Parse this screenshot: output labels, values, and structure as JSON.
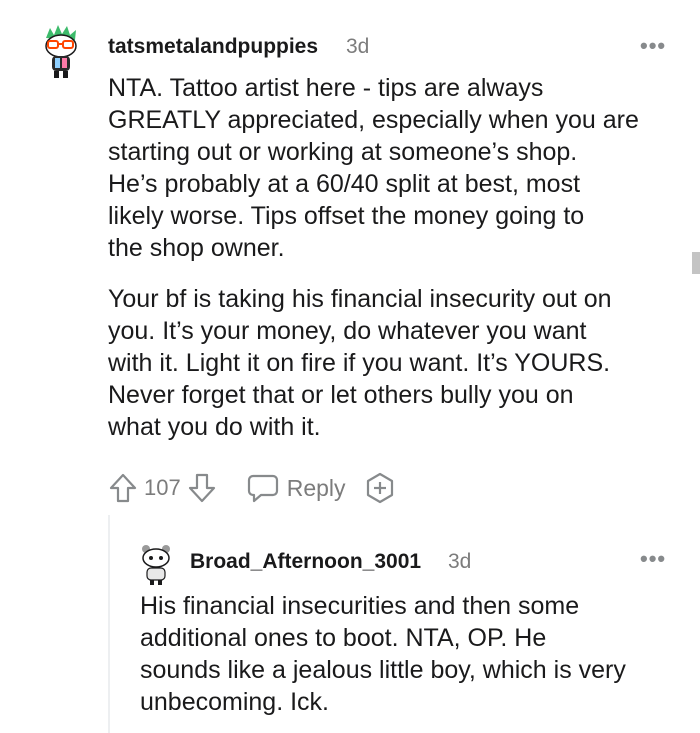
{
  "comment1": {
    "username": "tatsmetalandpuppies",
    "time": "3d",
    "more_label": "•••",
    "paragraphs": [
      [
        "NTA. Tattoo artist here - tips are always",
        "GREATLY appreciated, especially when you are",
        "starting out or working at someone’s shop.",
        "He’s probably at a 60/40 split at best, most",
        "likely worse. Tips offset the money going to",
        "the shop owner."
      ],
      [
        "Your bf is taking his financial insecurity out on",
        "you. It’s your money, do whatever you want",
        "with it. Light it on fire if you want. It’s YOURS.",
        "Never forget that or let others bully you on",
        "what you do with it."
      ]
    ],
    "vote_count": "107",
    "reply_label": "Reply",
    "icons": [
      "avatar",
      "upvote-icon",
      "downvote-icon",
      "reply-icon",
      "award-icon",
      "more-icon"
    ]
  },
  "comment2": {
    "username": "Broad_Afternoon_3001",
    "time": "3d",
    "more_label": "•••",
    "lines": [
      "His financial insecurities and then some",
      "additional ones to boot. NTA, OP. He",
      "sounds like a jealous little boy, which is very",
      "unbecoming. Ick."
    ]
  },
  "colors": {
    "text": "#1a1a1b",
    "meta": "#7c7c7c",
    "icon": "#878a8c"
  }
}
